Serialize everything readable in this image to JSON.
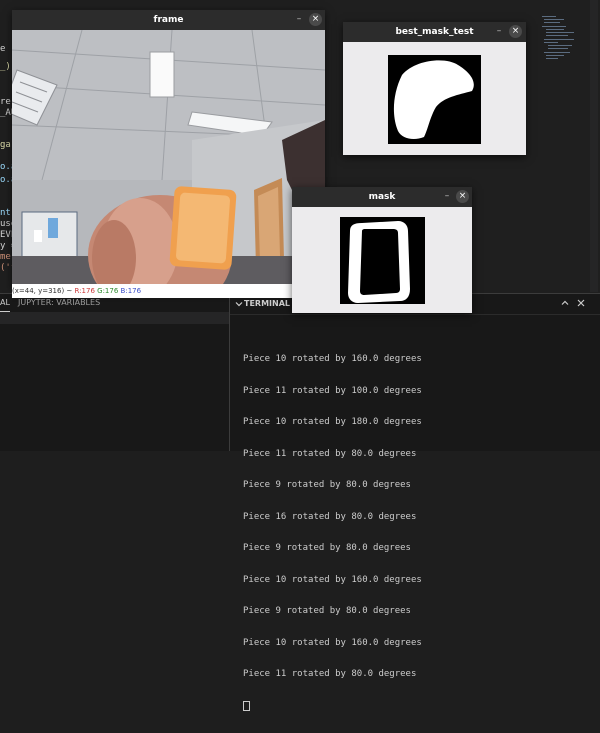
{
  "editor": {
    "code_fragments": [
      {
        "text": "e"
      },
      {
        "text": "_)"
      },
      {
        "text": "re("
      },
      {
        "text": "_AU"
      },
      {
        "text": "ga"
      },
      {
        "text": "o.a"
      },
      {
        "text": "o.a"
      },
      {
        "text": "nt,"
      },
      {
        "text": "use"
      },
      {
        "text": "EVE"
      },
      {
        "text": "y ="
      },
      {
        "text": "me'"
      },
      {
        "text": "('f"
      }
    ]
  },
  "panels": {
    "left_tabs": {
      "active": "AL",
      "jupyter": "JUPYTER: VARIABLES"
    },
    "terminal": {
      "title": "TERMINAL",
      "lines": [
        "Piece 10 rotated by 160.0 degrees",
        "Piece 11 rotated by 100.0 degrees",
        "Piece 10 rotated by 180.0 degrees",
        "Piece 11 rotated by 80.0 degrees",
        "Piece 9 rotated by 80.0 degrees",
        "Piece 16 rotated by 80.0 degrees",
        "Piece 9 rotated by 80.0 degrees",
        "Piece 10 rotated by 160.0 degrees",
        "Piece 9 rotated by 80.0 degrees",
        "Piece 10 rotated by 160.0 degrees",
        "Piece 11 rotated by 80.0 degrees"
      ]
    }
  },
  "windows": {
    "frame": {
      "title": "frame",
      "status": {
        "coords": "(x=44, y=316) ~",
        "r": "R:176",
        "g": "G:176",
        "b": "B:176"
      }
    },
    "best_mask_test": {
      "title": "best_mask_test"
    },
    "mask": {
      "title": "mask"
    },
    "minimize_glyph": "–",
    "close_glyph": "×"
  },
  "colors": {
    "editor_bg": "#1f1f1f",
    "titlebar": "#2c2c2c",
    "window_bg": "#ecebed",
    "piece_orange": "#f0a04e"
  }
}
